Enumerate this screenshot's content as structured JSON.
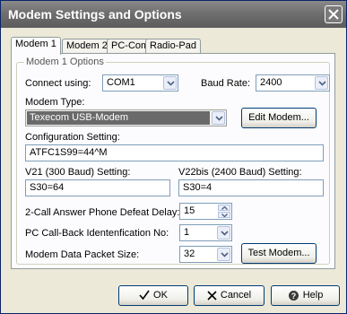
{
  "window": {
    "title": "Modem Settings and Options"
  },
  "tabs": [
    {
      "label": "Modem 1",
      "active": true
    },
    {
      "label": "Modem 2",
      "active": false
    },
    {
      "label": "PC-Com",
      "active": false
    },
    {
      "label": "Radio-Pad",
      "active": false
    }
  ],
  "group": {
    "legend": "Modem 1 Options"
  },
  "connect": {
    "label": "Connect using:",
    "value": "COM1"
  },
  "baud": {
    "label": "Baud Rate:",
    "value": "2400"
  },
  "modem_type": {
    "label": "Modem Type:",
    "value": "Texecom USB-Modem"
  },
  "edit_modem": {
    "label": "Edit Modem..."
  },
  "config": {
    "label": "Configuration Setting:",
    "value": "ATFC1S99=44^M"
  },
  "v21": {
    "label": "V21 (300 Baud) Setting:",
    "value": "S30=64"
  },
  "v22bis": {
    "label": "V22bis (2400 Baud) Setting:",
    "value": "S30=4"
  },
  "two_call": {
    "label": "2-Call Answer Phone Defeat Delay:",
    "value": "15"
  },
  "callback": {
    "label": "PC Call-Back Identenfication No:",
    "value": "1"
  },
  "packet": {
    "label": "Modem Data Packet Size:",
    "value": "32"
  },
  "test_modem": {
    "label": "Test Modem..."
  },
  "buttons": {
    "ok": "OK",
    "cancel": "Cancel",
    "help": "Help"
  }
}
